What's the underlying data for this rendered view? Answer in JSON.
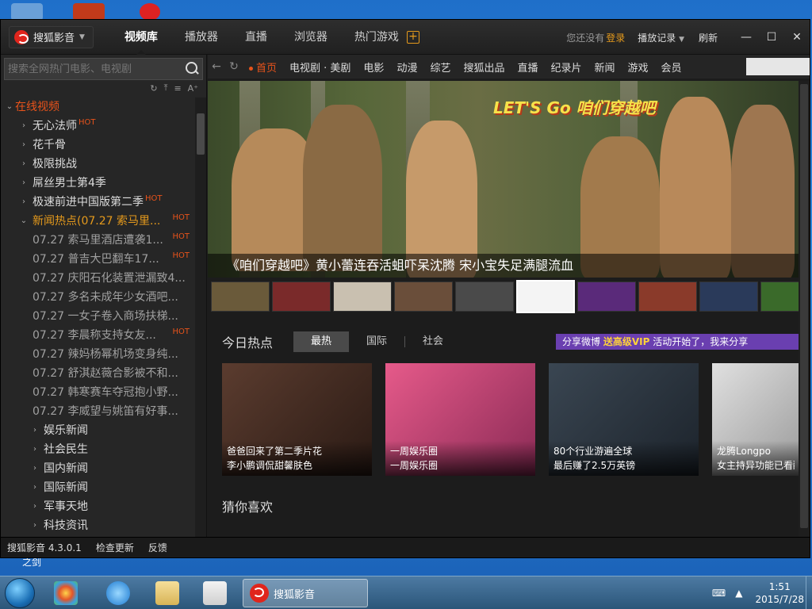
{
  "window": {
    "app_menu_label": "搜狐影音",
    "tabs": [
      "视频库",
      "播放器",
      "直播",
      "浏览器",
      "热门游戏"
    ],
    "active_tab_index": 0,
    "not_logged_text": "您还没有",
    "login_label": "登录",
    "history_label": "播放记录",
    "refresh_label": "刷新"
  },
  "sidebar": {
    "search_placeholder": "搜索全网热门电影、电视剧",
    "root_label": "在线视频",
    "items": [
      {
        "label": "无心法师",
        "hot": "HOT"
      },
      {
        "label": "花千骨",
        "hot": ""
      },
      {
        "label": "极限挑战",
        "hot": ""
      },
      {
        "label": "屌丝男士第4季",
        "hot": ""
      },
      {
        "label": "极速前进中国版第二季",
        "hot": "HOT"
      }
    ],
    "expanded_item": {
      "label": "新闻热点(07.27 索马里...",
      "hot": "HOT"
    },
    "news_items": [
      {
        "label": "07.27 索马里酒店遭袭1...",
        "hot": "HOT"
      },
      {
        "label": "07.27 普吉大巴翻车17...",
        "hot": "HOT"
      },
      {
        "label": "07.27 庆阳石化装置泄漏致4...",
        "hot": ""
      },
      {
        "label": "07.27 多名未成年少女酒吧...",
        "hot": ""
      },
      {
        "label": "07.27 一女子卷入商场扶梯...",
        "hot": ""
      },
      {
        "label": "07.27 李晨称支持女友...",
        "hot": "HOT"
      },
      {
        "label": "07.27 辣妈杨幂机场变身纯...",
        "hot": ""
      },
      {
        "label": "07.27 舒淇赵薇合影被不和...",
        "hot": ""
      },
      {
        "label": "07.27 韩寒赛车夺冠抱小野...",
        "hot": ""
      },
      {
        "label": "07.27 李威望与姚笛有好事...",
        "hot": ""
      }
    ],
    "sub_categories": [
      "娱乐新闻",
      "社会民生",
      "国内新闻",
      "国际新闻",
      "军事天地",
      "科技资讯"
    ]
  },
  "nav": {
    "home_label": "首页",
    "items": [
      "电视剧 · 美剧",
      "电影",
      "动漫",
      "综艺",
      "搜狐出品",
      "直播",
      "纪录片",
      "新闻",
      "游戏",
      "会员"
    ]
  },
  "hero": {
    "logo_text": "LET'S Go 咱们穿越吧",
    "caption": "《咱们穿越吧》黄小蕾连吞活蛆吓呆沈腾 宋小宝失足满腿流血"
  },
  "thumb_colors": [
    "#6a5a3a",
    "#7a2a2a",
    "#c9c0b0",
    "#6a4e3a",
    "#4a4a4a",
    "#f4f4f4",
    "#5a2a7a",
    "#8a3a2a",
    "#2a3a5a",
    "#3a6a2a"
  ],
  "hot_section": {
    "title": "今日热点",
    "tabs": [
      "最热",
      "国际",
      "社会"
    ],
    "active_tab_index": 0,
    "promo_prefix": "分享微博",
    "promo_vip": "送高级VIP",
    "promo_suffix": "活动开始了，我来分享",
    "cards": [
      {
        "line1": "爸爸回来了第二季片花",
        "line2": "李小鹏调侃甜馨肤色",
        "color": "#5b3c2f"
      },
      {
        "line1": "一周娱乐圈",
        "line2": "一周娱乐圈",
        "color": "#c73c6f"
      },
      {
        "line1": "80个行业游遍全球",
        "line2": "最后赚了2.5万英镑",
        "color": "#2c3540"
      },
      {
        "line1": "龙腾Longpo",
        "line2": "女主持异功能已看醉",
        "color": "#c9c9c9"
      }
    ]
  },
  "guess_title": "猜你喜欢",
  "status": {
    "version": "搜狐影音 4.3.0.1",
    "check_update": "检查更新",
    "feedback": "反馈"
  },
  "desktop_label": "之剑",
  "taskbar": {
    "task_label": "搜狐影音",
    "time": "1:51",
    "date": "2015/7/28"
  }
}
